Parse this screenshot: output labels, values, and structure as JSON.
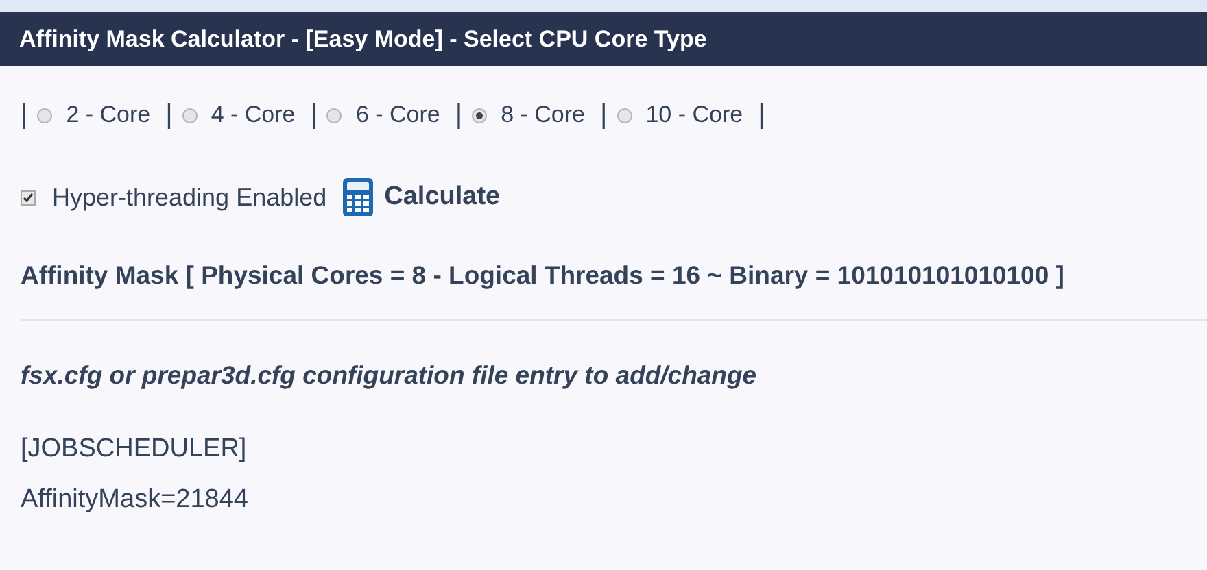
{
  "window": {
    "title": "Affinity Mask Calculator - [Easy Mode] - Select CPU Core Type"
  },
  "core_options": [
    {
      "separator": "|",
      "label": "2 - Core",
      "selected": false
    },
    {
      "separator": "|",
      "label": "4 - Core",
      "selected": false
    },
    {
      "separator": "|",
      "label": "6 - Core",
      "selected": false
    },
    {
      "separator": "|",
      "label": "8 - Core",
      "selected": true
    },
    {
      "separator": "|",
      "label": "10 - Core",
      "selected": false
    }
  ],
  "trailing_separator": "|",
  "hyperthreading": {
    "label": "Hyper-threading Enabled",
    "checked": true
  },
  "calculate_button": {
    "label": "Calculate"
  },
  "result": "Affinity Mask [ Physical Cores = 8 - Logical Threads = 16 ~ Binary = 101010101010100 ]",
  "config_heading": "fsx.cfg or prepar3d.cfg configuration file entry to add/change",
  "config_lines": [
    "[JOBSCHEDULER]",
    "AffinityMask=21844"
  ]
}
